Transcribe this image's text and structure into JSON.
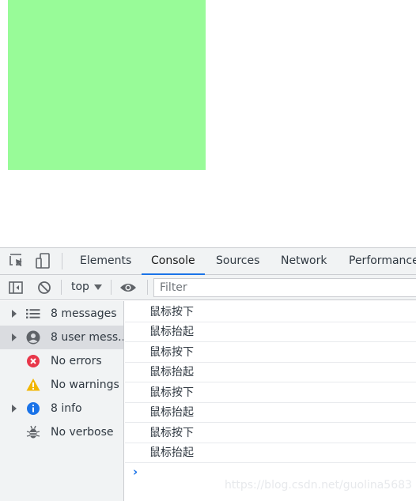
{
  "page": {
    "box_color": "#98fb98"
  },
  "devtools": {
    "tabs": [
      {
        "label": "Elements",
        "active": false
      },
      {
        "label": "Console",
        "active": true
      },
      {
        "label": "Sources",
        "active": false
      },
      {
        "label": "Network",
        "active": false
      },
      {
        "label": "Performance",
        "active": false
      }
    ],
    "toolbar": {
      "context": "top",
      "filter_placeholder": "Filter"
    },
    "sidebar": [
      {
        "label": "8 messages",
        "icon": "list-icon",
        "expandable": true,
        "selected": false
      },
      {
        "label": "8 user mess...",
        "icon": "user-icon",
        "expandable": true,
        "selected": true
      },
      {
        "label": "No errors",
        "icon": "error-icon",
        "expandable": false,
        "selected": false
      },
      {
        "label": "No warnings",
        "icon": "warning-icon",
        "expandable": false,
        "selected": false
      },
      {
        "label": "8 info",
        "icon": "info-icon",
        "expandable": true,
        "selected": false
      },
      {
        "label": "No verbose",
        "icon": "bug-icon",
        "expandable": false,
        "selected": false
      }
    ],
    "console_messages": [
      "鼠标按下",
      "鼠标抬起",
      "鼠标按下",
      "鼠标抬起",
      "鼠标按下",
      "鼠标抬起",
      "鼠标按下",
      "鼠标抬起"
    ],
    "prompt_symbol": "›"
  },
  "watermark": "https://blog.csdn.net/guolina5683",
  "colors": {
    "accent": "#1a73e8",
    "error": "#e8374a",
    "warning": "#f2b600",
    "info": "#1a73e8"
  }
}
